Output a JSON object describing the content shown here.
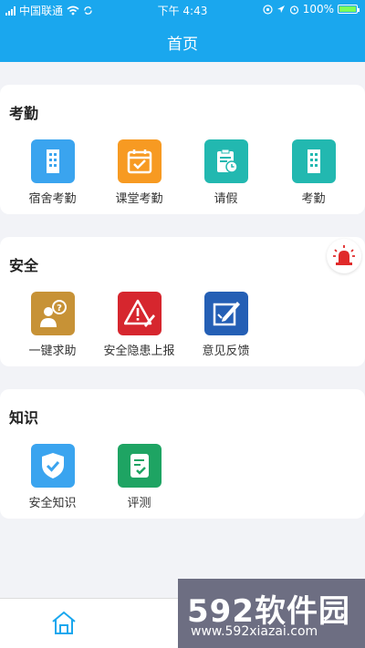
{
  "status": {
    "carrier": "中国联通",
    "time": "下午 4:43",
    "battery": "100%",
    "battery_level": 1.0
  },
  "header": {
    "title": "首页"
  },
  "sections": [
    {
      "title": "考勤",
      "items": [
        {
          "label": "宿舍考勤",
          "icon": "building-icon",
          "color": "#3aa4ef"
        },
        {
          "label": "课堂考勤",
          "icon": "calendar-check-icon",
          "color": "#f79a22"
        },
        {
          "label": "请假",
          "icon": "clipboard-clock-icon",
          "color": "#22b8b0"
        },
        {
          "label": "考勤",
          "icon": "building-icon",
          "color": "#22b8b0"
        }
      ]
    },
    {
      "title": "安全",
      "items": [
        {
          "label": "一键求助",
          "icon": "person-question-icon",
          "color": "#c79236"
        },
        {
          "label": "安全隐患上报",
          "icon": "warning-pencil-icon",
          "color": "#d6262e"
        },
        {
          "label": "意见反馈",
          "icon": "edit-square-icon",
          "color": "#245fb5"
        }
      ]
    },
    {
      "title": "知识",
      "items": [
        {
          "label": "安全知识",
          "icon": "shield-check-icon",
          "color": "#3aa4ef"
        },
        {
          "label": "评测",
          "icon": "document-check-icon",
          "color": "#1ea463"
        }
      ]
    }
  ],
  "alarm": {
    "icon": "siren-icon"
  },
  "tabbar": {
    "home_icon": "home-icon"
  },
  "watermark": {
    "logo": "592软件园",
    "url": "www.592xiazai.com"
  }
}
